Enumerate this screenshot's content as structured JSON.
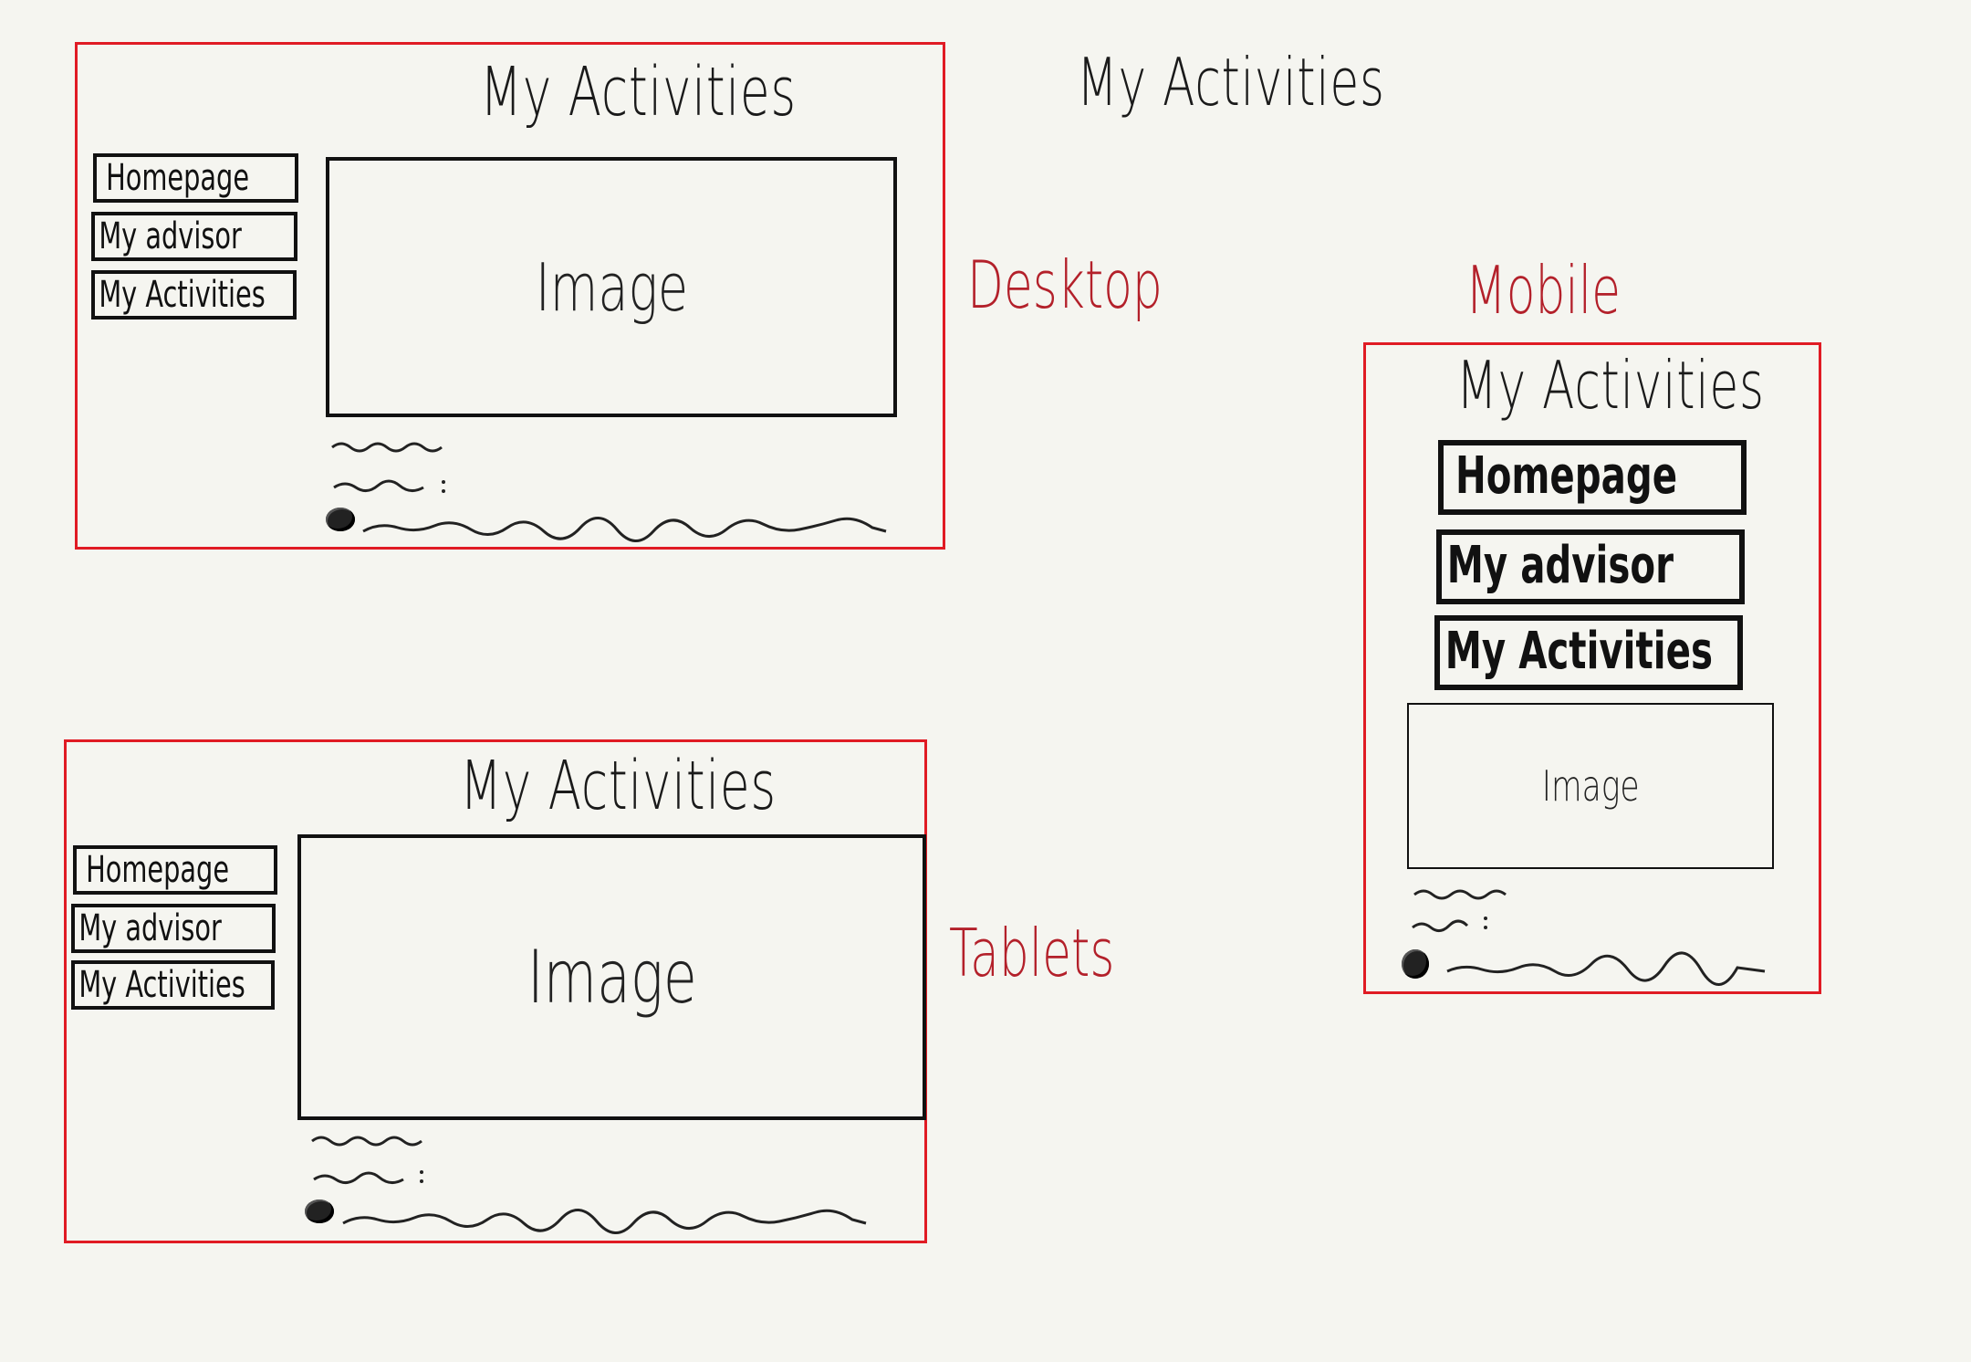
{
  "floating_title": "My Activities",
  "desktop": {
    "label": "Desktop",
    "title": "My Activities",
    "nav": [
      "Homepage",
      "My advisor",
      "My Activities"
    ],
    "image_label": "Image"
  },
  "tablet": {
    "label": "Tablets",
    "title": "My Activities",
    "nav": [
      "Homepage",
      "My advisor",
      "My Activities"
    ],
    "image_label": "Image"
  },
  "mobile": {
    "label": "Mobile",
    "title": "My Activities",
    "nav": [
      "Homepage",
      "My advisor",
      "My Activities"
    ],
    "image_label": "Image"
  },
  "colors": {
    "background": "#f5f5f0",
    "frame": "#e01b24",
    "label": "#b3202a",
    "ink": "#111111"
  }
}
